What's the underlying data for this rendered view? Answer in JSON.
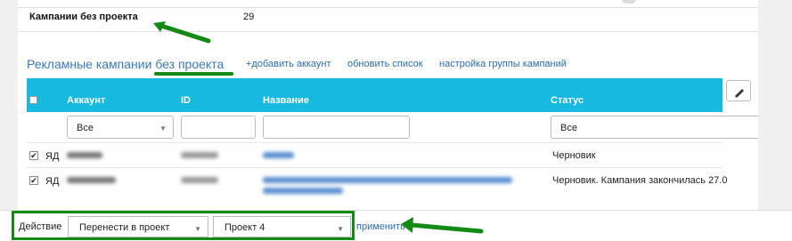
{
  "summary": {
    "label": "Кампании без проекта",
    "value": "29"
  },
  "section": {
    "title": "Рекламные кампании без проекта",
    "links": [
      "+добавить аккаунт",
      "обновить список",
      "настройка группы кампаний"
    ]
  },
  "table": {
    "columns": [
      "Аккаунт",
      "ID",
      "Название",
      "Статус"
    ],
    "filters": {
      "account": "Все",
      "status": "Все"
    },
    "rows": [
      {
        "checked": "✔",
        "type": "ЯД",
        "status": "Черновик"
      },
      {
        "checked": "✔",
        "type": "ЯД",
        "status": "Черновик. Кампания закончилась 27.0"
      }
    ]
  },
  "footer": {
    "action_label": "Действие",
    "action_value": "Перенести в проект",
    "project_value": "Проект 4",
    "apply_label": "применить"
  },
  "colors": {
    "header": "#18b9e0",
    "link": "#2a6db0",
    "highlight": "#138a13"
  },
  "icons": {
    "edit": "pencil-icon",
    "arrow": "green-arrow",
    "caret": "caret-down-icon"
  }
}
